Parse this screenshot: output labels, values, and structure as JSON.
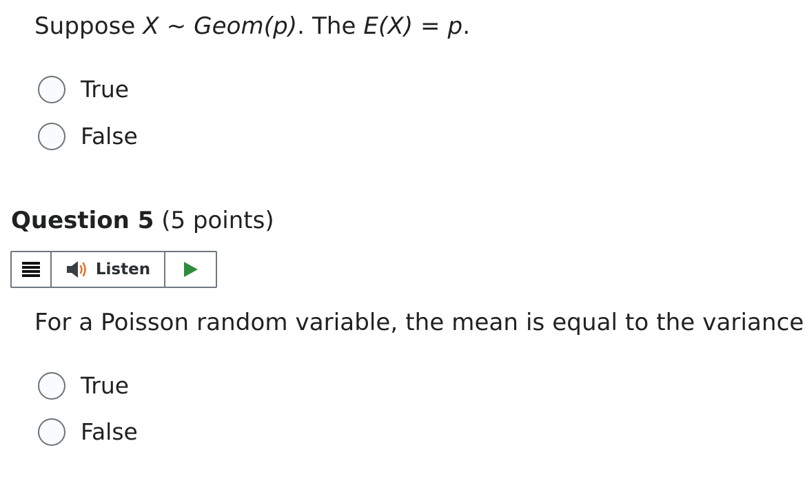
{
  "previous_question": {
    "stem_parts": {
      "prefix": "Suppose ",
      "math1": "X ~ Geom(p)",
      "middle": ". The ",
      "math2": "E(X) = p",
      "suffix": "."
    },
    "choices": [
      {
        "label": "True",
        "selected": false
      },
      {
        "label": "False",
        "selected": false
      }
    ]
  },
  "question": {
    "number_label": "Question 5",
    "points_label": "(5 points)",
    "listen_toolbar": {
      "menu_icon": "menu-icon",
      "speaker_icon": "speaker-icon",
      "listen_label": "Listen",
      "play_icon": "play-icon",
      "play_color": "#2e8b3d",
      "speaker_color": "#3a3f44",
      "wave_color": "#e0702a"
    },
    "stem": "For a Poisson random variable, the mean is equal to the variance.",
    "choices": [
      {
        "label": "True",
        "selected": false
      },
      {
        "label": "False",
        "selected": false
      }
    ]
  }
}
